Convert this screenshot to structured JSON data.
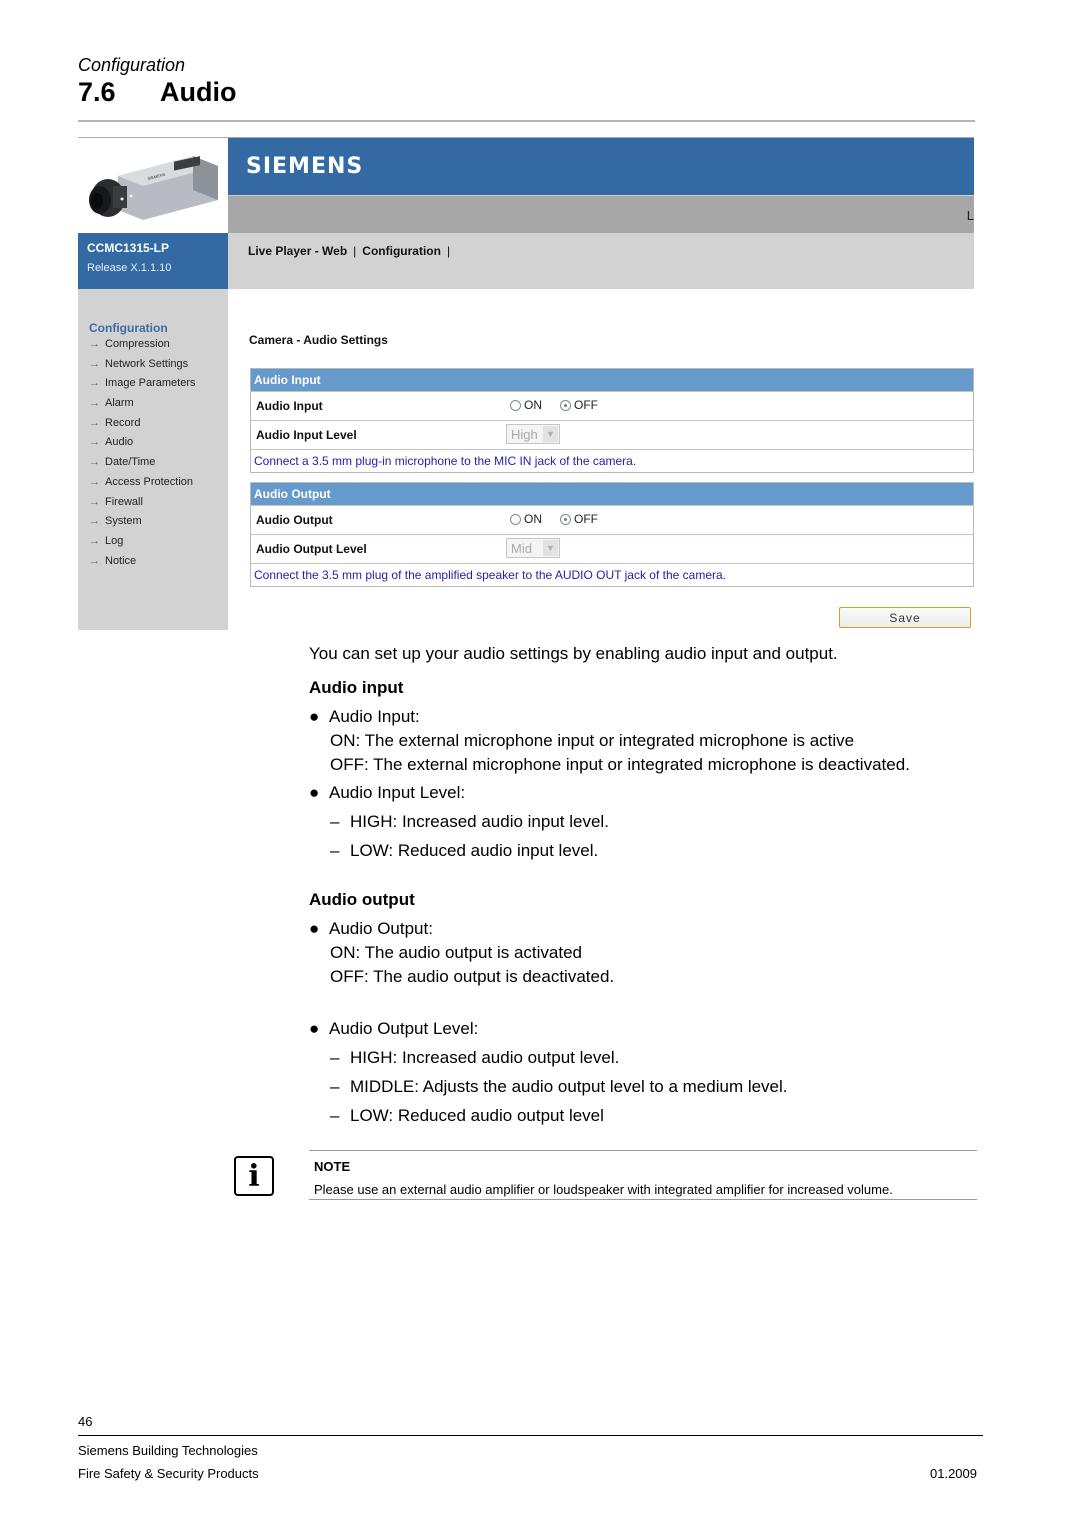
{
  "page": {
    "breadcrumb": "Configuration",
    "section_number": "7.6",
    "section_title": "Audio"
  },
  "webui": {
    "brand": "SIEMENS",
    "grey_bar_text": "L",
    "model": "CCMC1315-LP",
    "release": "Release X.1.1.10",
    "nav": [
      "Live Player - Web",
      "Configuration"
    ],
    "nav_separator": "|",
    "sidebar": {
      "heading": "Configuration",
      "items": [
        "Compression",
        "Network Settings",
        "Image Parameters",
        "Alarm",
        "Record",
        "Audio",
        "Date/Time",
        "Access Protection",
        "Firewall",
        "System",
        "Log",
        "Notice"
      ]
    },
    "page_heading": "Camera - Audio Settings",
    "audio_input": {
      "panel_title": "Audio Input",
      "toggle_label": "Audio Input",
      "on_label": "ON",
      "off_label": "OFF",
      "selected": "OFF",
      "level_label": "Audio Input Level",
      "level_value": "High",
      "info": "Connect a 3.5 mm plug-in microphone to the MIC IN jack of the camera."
    },
    "audio_output": {
      "panel_title": "Audio Output",
      "toggle_label": "Audio Output",
      "on_label": "ON",
      "off_label": "OFF",
      "selected": "OFF",
      "level_label": "Audio Output Level",
      "level_value": "Mid",
      "info": "Connect the 3.5 mm plug of the amplified speaker to the AUDIO OUT jack of the camera."
    },
    "save_label": "Save"
  },
  "doc": {
    "intro": "You can set up your audio settings by enabling audio input and output.",
    "input_heading": "Audio input",
    "input_bullet1": "Audio Input:",
    "input_on": "ON: The external microphone input or integrated microphone is active",
    "input_off": "OFF: The external microphone input or integrated microphone is deactivated.",
    "input_bullet2": "Audio Input Level:",
    "input_levels": [
      "HIGH: Increased audio input level.",
      "LOW: Reduced audio input level."
    ],
    "output_heading": "Audio output",
    "output_bullet1": "Audio Output:",
    "output_on": "ON: The audio output is activated",
    "output_off": "OFF: The audio output is deactivated.",
    "output_bullet2": "Audio Output Level:",
    "output_levels": [
      "HIGH: Increased audio output level.",
      "MIDDLE: Adjusts the audio output level to a medium level.",
      "LOW: Reduced audio output level"
    ],
    "bullet_glyph": "●",
    "dash_glyph": "–"
  },
  "note": {
    "icon": "info-icon",
    "icon_glyph": "i",
    "label": "NOTE",
    "text": "Please use an external audio amplifier or loudspeaker with integrated amplifier for increased volume."
  },
  "footer": {
    "page_number": "46",
    "company": "Siemens Building Technologies",
    "division": "Fire Safety & Security Products",
    "date": "01.2009"
  },
  "colors": {
    "brand_blue": "#336aa4",
    "panel_header": "#6699cc",
    "info_text": "#2222aa"
  }
}
